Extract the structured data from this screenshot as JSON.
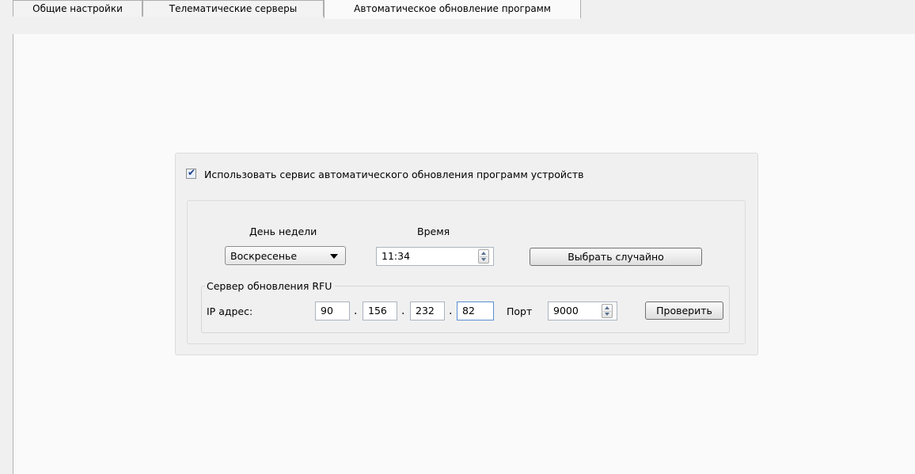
{
  "tabs": [
    {
      "label": "Общие настройки",
      "active": false
    },
    {
      "label": "Телематические серверы",
      "active": false
    },
    {
      "label": "Автоматическое обновление программ",
      "active": true
    }
  ],
  "auto_update": {
    "enabled": true,
    "checkbox_label": "Использовать сервис автоматического обновления программ устройств",
    "day_label": "День недели",
    "day_value": "Воскресенье",
    "time_label": "Время",
    "time_value": "11:34",
    "random_button": "Выбрать случайно",
    "server": {
      "title": "Сервер обновления RFU",
      "ip_label": "IP адрес:",
      "ip": [
        "90",
        "156",
        "232",
        "82"
      ],
      "ip_separator": ".",
      "port_label": "Порт",
      "port_value": "9000",
      "check_button": "Проверить"
    }
  },
  "icons": {
    "checkbox_mark": "✔"
  },
  "colors": {
    "tab_panel": "#fafafa",
    "window_bg": "#f0f0f0",
    "focus_border": "#5b8ed3"
  }
}
